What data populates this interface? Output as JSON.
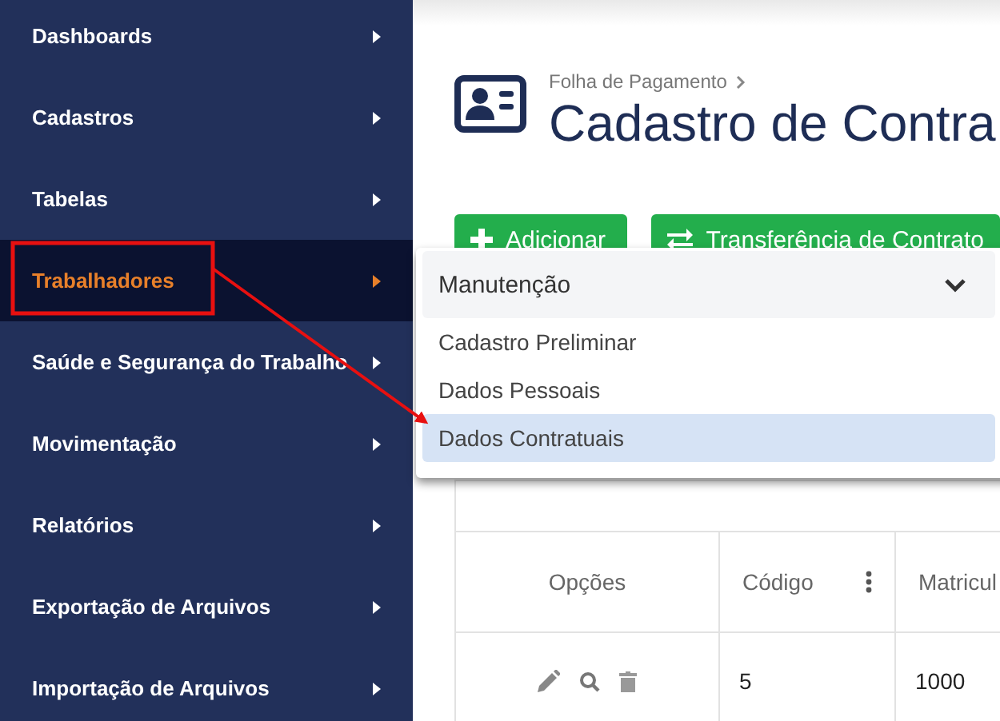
{
  "sidebar": {
    "items": [
      {
        "label": "Dashboards",
        "selected": false
      },
      {
        "label": "Cadastros",
        "selected": false
      },
      {
        "label": "Tabelas",
        "selected": false
      },
      {
        "label": "Trabalhadores",
        "selected": true
      },
      {
        "label": "Saúde e Segurança do Trabalho",
        "selected": false
      },
      {
        "label": "Movimentação",
        "selected": false
      },
      {
        "label": "Relatórios",
        "selected": false
      },
      {
        "label": "Exportação de Arquivos",
        "selected": false
      },
      {
        "label": "Importação de Arquivos",
        "selected": false
      }
    ]
  },
  "page": {
    "breadcrumb": "Folha de Pagamento",
    "title": "Cadastro de Contra"
  },
  "actions": [
    {
      "label": "Adicionar",
      "kind": "plus"
    },
    {
      "label": "Transferência de Contrato",
      "kind": "transfer"
    }
  ],
  "menu": {
    "group": "Manutenção",
    "expanded": true,
    "items": [
      {
        "label": "Cadastro Preliminar",
        "selected": false
      },
      {
        "label": "Dados Pessoais",
        "selected": false
      },
      {
        "label": "Dados Contratuais",
        "selected": true
      }
    ]
  },
  "table": {
    "columns": [
      {
        "label": "Opções",
        "menu": false
      },
      {
        "label": "Código",
        "menu": true
      },
      {
        "label": "Matricul",
        "menu": false
      }
    ],
    "rows": [
      {
        "cells": [
          "",
          "5",
          "1000"
        ]
      }
    ]
  }
}
